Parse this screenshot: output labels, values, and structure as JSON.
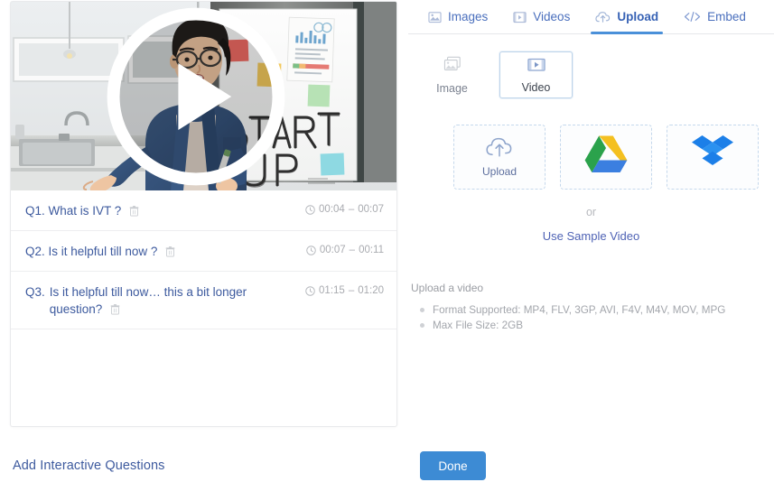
{
  "left": {
    "video": {
      "play_icon": "play-circle-icon",
      "scene_text_1": "START",
      "scene_text_2": "UP"
    },
    "questions": [
      {
        "label": "Q1.",
        "text": "What is IVT ?",
        "delete_icon": "trash-icon",
        "clock_icon": "clock-icon",
        "time_start": "00:04",
        "time_sep": "–",
        "time_end": "00:07"
      },
      {
        "label": "Q2.",
        "text": "Is it helpful till now ?",
        "delete_icon": "trash-icon",
        "clock_icon": "clock-icon",
        "time_start": "00:07",
        "time_sep": "–",
        "time_end": "00:11"
      },
      {
        "label": "Q3.",
        "text": "Is it helpful till now… this a bit longer question?",
        "delete_icon": "trash-icon",
        "clock_icon": "clock-icon",
        "time_start": "01:15",
        "time_sep": "–",
        "time_end": "01:20"
      }
    ],
    "add_questions_link": "Add Interactive Questions"
  },
  "right": {
    "tabs": [
      {
        "label": "Images",
        "icon": "image-icon",
        "active": false
      },
      {
        "label": "Videos",
        "icon": "film-icon",
        "active": false
      },
      {
        "label": "Upload",
        "icon": "cloud-upload-icon",
        "active": true
      },
      {
        "label": "Embed",
        "icon": "code-icon",
        "active": false
      }
    ],
    "media_toggle": [
      {
        "label": "Image",
        "icon": "image-stack-icon",
        "selected": false
      },
      {
        "label": "Video",
        "icon": "film-icon",
        "selected": true
      }
    ],
    "sources": [
      {
        "label": "Upload",
        "icon": "cloud-upload-icon"
      },
      {
        "label": "",
        "icon": "google-drive-icon"
      },
      {
        "label": "",
        "icon": "dropbox-icon"
      }
    ],
    "or_text": "or",
    "sample_link": "Use Sample Video",
    "notes": {
      "title": "Upload a video",
      "items": [
        "Format Supported: MP4, FLV, 3GP, AVI, F4V, M4V, MOV, MPG",
        "Max File Size: 2GB"
      ]
    },
    "done_label": "Done"
  },
  "colors": {
    "accent_blue": "#3d8bd4",
    "tab_active_underline": "#4a90d9",
    "link_blue": "#3d5a9e",
    "muted_gray": "#a3a6ac",
    "dashed_border": "#c5d8ec"
  }
}
